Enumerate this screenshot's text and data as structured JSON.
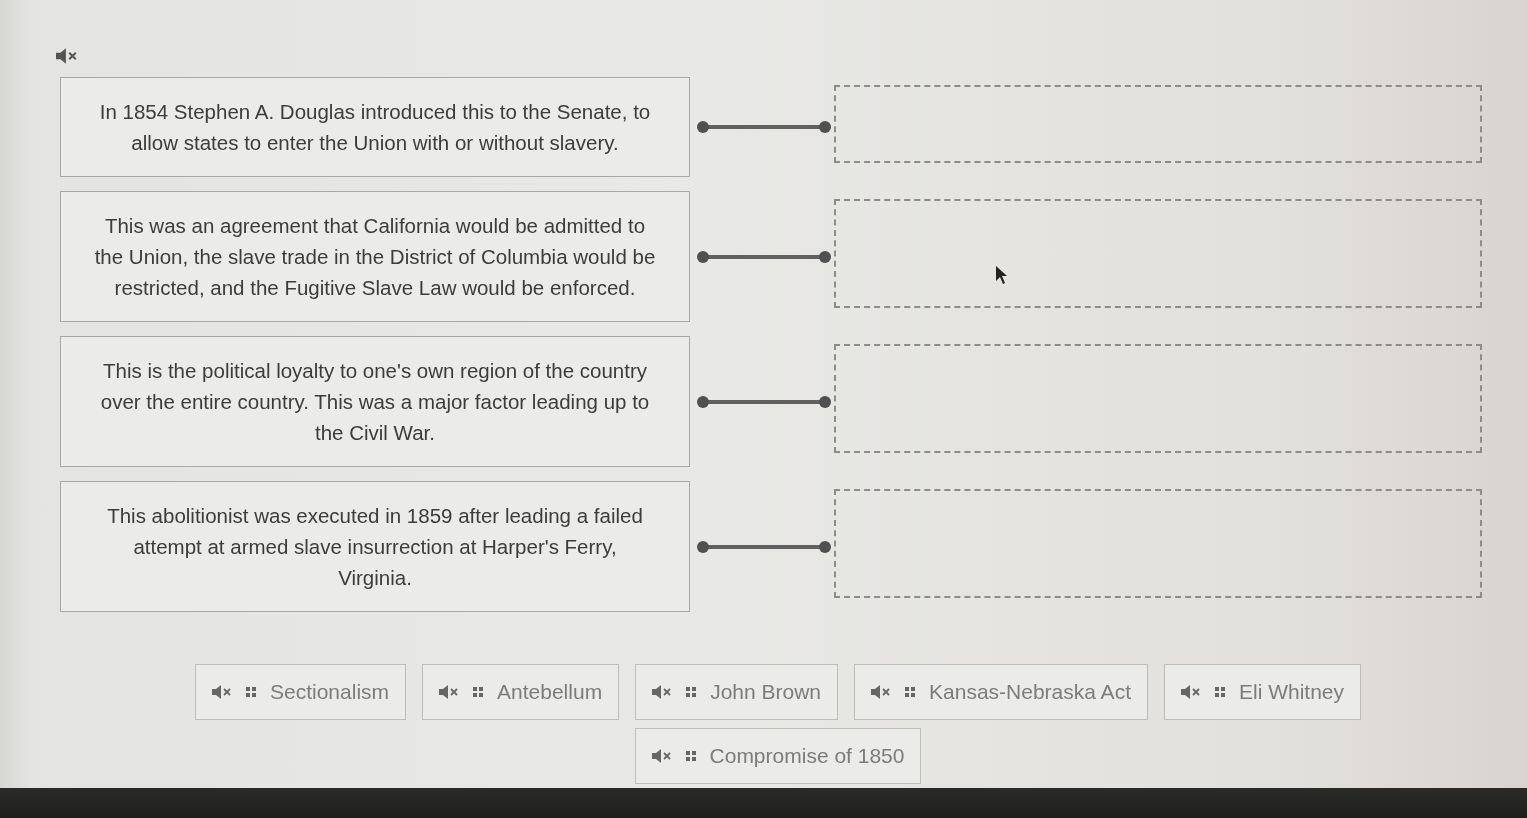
{
  "prompts": [
    {
      "text": "In 1854 Stephen A. Douglas introduced this to the Senate, to\nallow states to enter the Union with or without slavery."
    },
    {
      "text": "This was an agreement that California would be admitted to\nthe Union, the slave trade in the District of Columbia would be\nrestricted, and the Fugitive Slave Law would be enforced."
    },
    {
      "text": "This is the political loyalty to one's own region of the country\nover the entire country. This was a major factor leading up to\nthe Civil War."
    },
    {
      "text": "This abolitionist was executed in 1859 after leading a failed\nattempt at armed slave insurrection at Harper's Ferry,\nVirginia."
    }
  ],
  "answer_bank": [
    {
      "label": "Sectionalism"
    },
    {
      "label": "Antebellum"
    },
    {
      "label": "John Brown"
    },
    {
      "label": "Kansas-Nebraska Act"
    },
    {
      "label": "Eli Whitney"
    },
    {
      "label": "Compromise of 1850"
    }
  ]
}
